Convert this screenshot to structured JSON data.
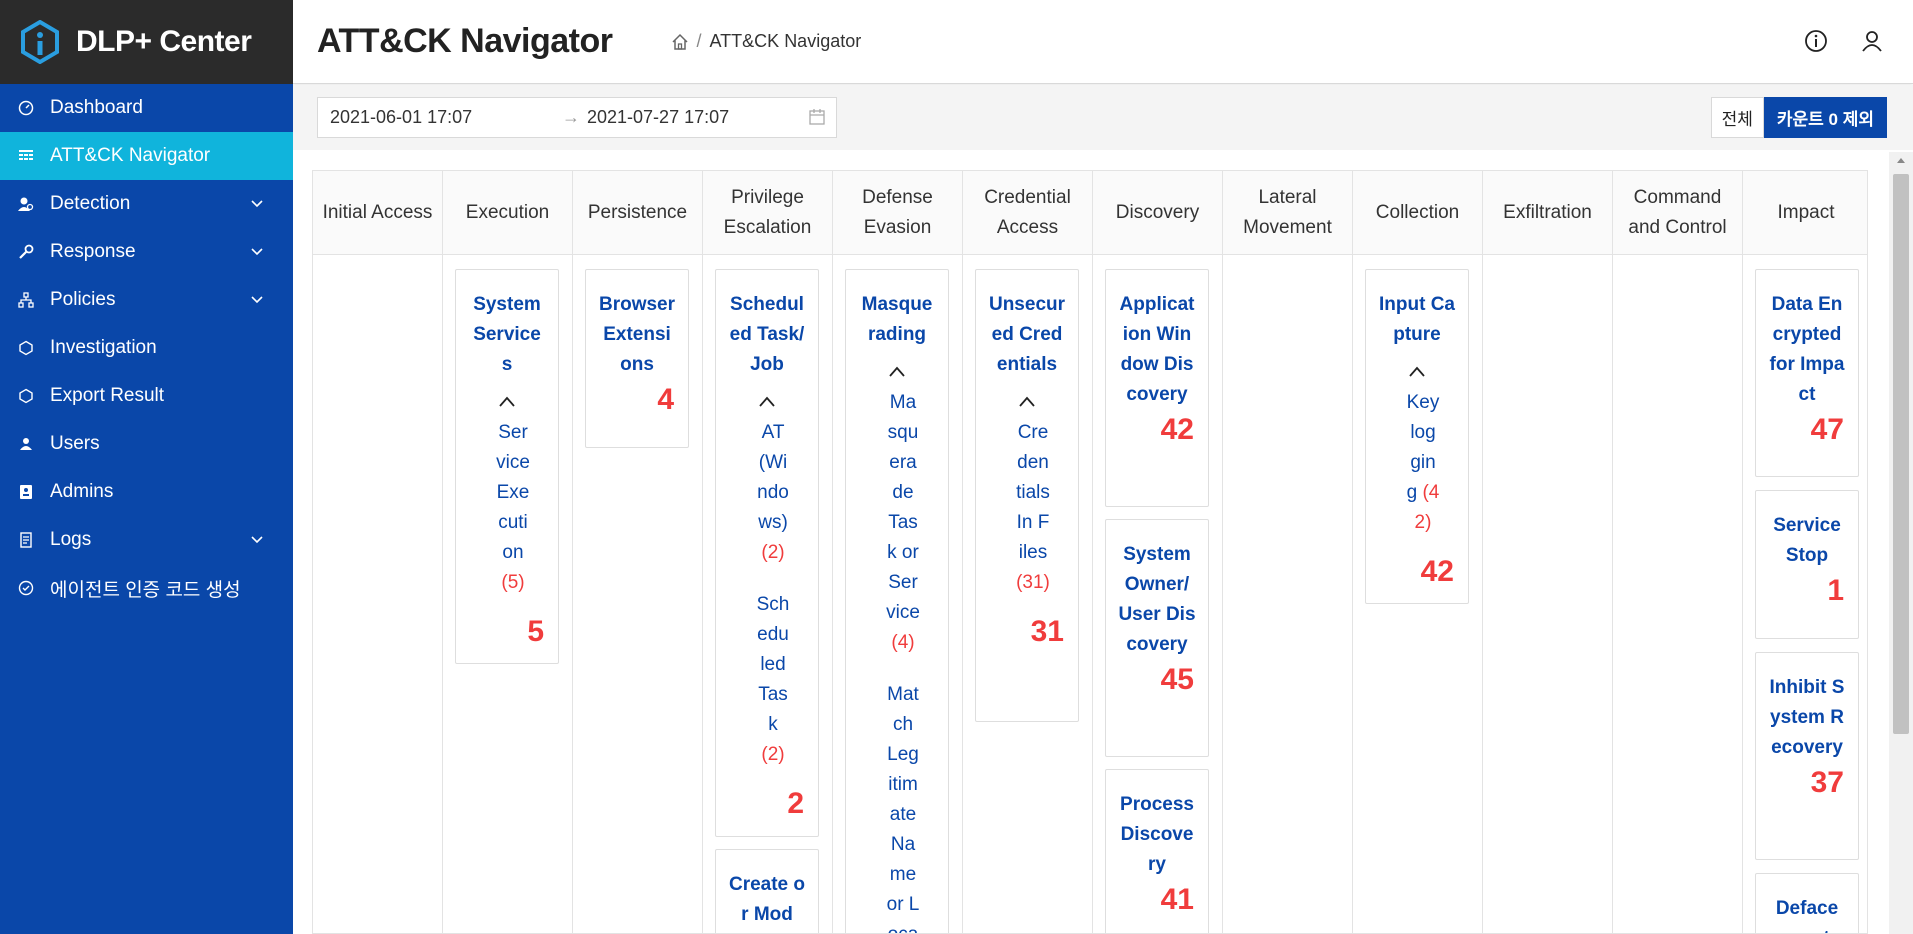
{
  "brand": {
    "name": "DLP+ Center",
    "icon": "shield-hex-logo"
  },
  "sidebar": {
    "items": [
      {
        "label": "Dashboard",
        "icon": "gauge-icon",
        "active": false,
        "has_children": false
      },
      {
        "label": "ATT&CK Navigator",
        "icon": "grid-icon",
        "active": true,
        "has_children": false
      },
      {
        "label": "Detection",
        "icon": "user-search-icon",
        "active": false,
        "has_children": true
      },
      {
        "label": "Response",
        "icon": "wrench-icon",
        "active": false,
        "has_children": true
      },
      {
        "label": "Policies",
        "icon": "sitemap-icon",
        "active": false,
        "has_children": true
      },
      {
        "label": "Investigation",
        "icon": "circle-dot-icon",
        "active": false,
        "has_children": false
      },
      {
        "label": "Export Result",
        "icon": "circle-dot-icon",
        "active": false,
        "has_children": false
      },
      {
        "label": "Users",
        "icon": "user-icon",
        "active": false,
        "has_children": false
      },
      {
        "label": "Admins",
        "icon": "id-card-icon",
        "active": false,
        "has_children": false
      },
      {
        "label": "Logs",
        "icon": "document-icon",
        "active": false,
        "has_children": true
      },
      {
        "label": "에이전트 인증 코드 생성",
        "icon": "check-circle-icon",
        "active": false,
        "has_children": false
      }
    ]
  },
  "header": {
    "title": "ATT&CK Navigator",
    "breadcrumb": {
      "separator": "/",
      "current": "ATT&CK Navigator"
    }
  },
  "toolbar": {
    "date_start": "2021-06-01 17:07",
    "date_end": "2021-07-27 17:07",
    "btn_all": "전체",
    "btn_exclude_zero": "카운트 0 제외"
  },
  "matrix": {
    "tactics": [
      "Initial Access",
      "Execution",
      "Persistence",
      "Privilege Escalation",
      "Defense Evasion",
      "Credential Access",
      "Discovery",
      "Lateral Movement",
      "Collection",
      "Exfiltration",
      "Command and Control",
      "Impact"
    ],
    "execution": {
      "system_services": {
        "title": "System Services",
        "subs": [
          {
            "name": "Service Execution",
            "count": "(5)"
          }
        ],
        "count": "5"
      }
    },
    "persistence": {
      "browser_extensions": {
        "title": "Browser Extensions",
        "count": "4"
      }
    },
    "privilege": {
      "scheduled_task": {
        "title": "Scheduled Task/Job",
        "subs": [
          {
            "name": "AT (Windows)",
            "count": "(2)"
          },
          {
            "name": "Scheduled Task",
            "count": "(2)"
          }
        ],
        "count": "2"
      },
      "create_modify": {
        "title": "Create or Mod"
      }
    },
    "defense": {
      "masquerading": {
        "title": "Masquerading",
        "subs": [
          {
            "name": "Masquerade Task or Service",
            "count": "(4)"
          },
          {
            "name": "Match Legitimate Name or Location"
          }
        ]
      }
    },
    "credential": {
      "unsecured": {
        "title": "Unsecured Credentials",
        "subs": [
          {
            "name": "Credentials In Files",
            "count": "(31)"
          }
        ],
        "count": "31"
      }
    },
    "discovery": {
      "app_window": {
        "title": "Application Window Discovery",
        "count": "42"
      },
      "system_owner": {
        "title": "System Owner/User Discovery",
        "count": "45"
      },
      "process": {
        "title": "Process Discovery",
        "count": "41"
      }
    },
    "collection": {
      "input_capture": {
        "title": "Input Capture",
        "subs": [
          {
            "name": "Keylogging",
            "count": "(42)"
          }
        ],
        "count": "42"
      }
    },
    "impact": {
      "data_encrypted": {
        "title": "Data Encrypted for Impact",
        "count": "47"
      },
      "service_stop": {
        "title": "Service Stop",
        "count": "1"
      },
      "inhibit_recovery": {
        "title": "Inhibit System Recovery",
        "count": "37"
      },
      "defacement": {
        "title": "Defacement"
      }
    }
  }
}
